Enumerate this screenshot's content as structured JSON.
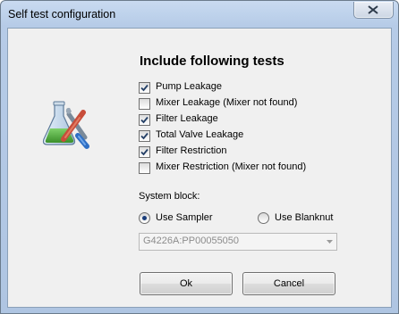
{
  "window": {
    "title": "Self test configuration"
  },
  "dialog": {
    "heading": "Include following tests",
    "tests": [
      {
        "label": "Pump Leakage",
        "checked": true
      },
      {
        "label": "Mixer Leakage (Mixer not found)",
        "checked": false
      },
      {
        "label": "Filter Leakage",
        "checked": true
      },
      {
        "label": "Total Valve Leakage",
        "checked": true
      },
      {
        "label": "Filter Restriction",
        "checked": true
      },
      {
        "label": "Mixer Restriction (Mixer not found)",
        "checked": false
      }
    ],
    "system_block": {
      "label": "System block:",
      "options": [
        {
          "label": "Use Sampler",
          "selected": true
        },
        {
          "label": "Use Blanknut",
          "selected": false
        }
      ],
      "combo_value": "G4226A:PP00055050"
    },
    "buttons": {
      "ok": "Ok",
      "cancel": "Cancel"
    }
  },
  "colors": {
    "title_bar": "#bfd3ec",
    "client_bg": "#f0f0f0",
    "check_mark": "#233f66"
  }
}
